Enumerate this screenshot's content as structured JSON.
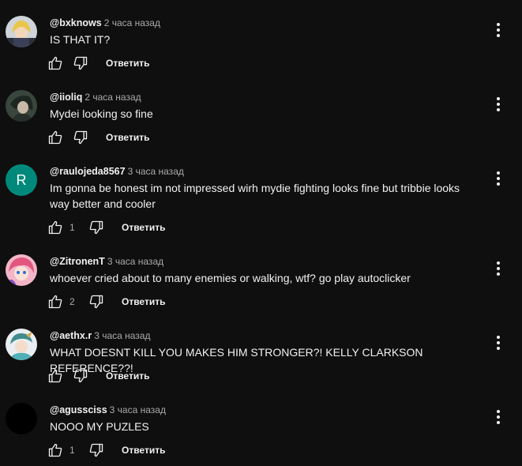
{
  "comments": [
    {
      "author": "@bxknows",
      "time": "2 часа назад",
      "lines": [
        "IS THAT IT?"
      ],
      "likes": "",
      "reply": "Ответить",
      "avatar": "avatar-bxknows"
    },
    {
      "author": "@iioliq",
      "time": "2 часа назад",
      "lines": [
        "Mydei looking so fine"
      ],
      "likes": "",
      "reply": "Ответить",
      "avatar": "avatar-iioliq"
    },
    {
      "author": "@raulojeda8567",
      "time": "3 часа назад",
      "lines": [
        "Im gonna be honest im not impressed wirh mydie fighting looks fine but tribbie looks",
        "way better and cooler"
      ],
      "likes": "1",
      "reply": "Ответить",
      "avatar_letter": "R",
      "avatar_color": "#00897b"
    },
    {
      "author": "@ZitronenT",
      "time": "3 часа назад",
      "lines": [
        "whoever cried about to many enemies or walking, wtf? go play autoclicker"
      ],
      "likes": "2",
      "reply": "Ответить",
      "avatar": "avatar-zitronent"
    },
    {
      "author": "@aethx.r",
      "time": "3 часа назад",
      "lines": [
        "WHAT DOESNT KILL YOU MAKES HIM STRONGER?! KELLY CLARKSON REFERENCE??!"
      ],
      "likes": "",
      "reply": "Ответить",
      "avatar": "avatar-aethx"
    },
    {
      "author": "@agussciss",
      "time": "3 часа назад",
      "lines": [
        "NOOO MY PUZLES"
      ],
      "likes": "1",
      "reply": "Ответить",
      "avatar": "avatar-agussciss"
    }
  ],
  "icons": {
    "like": "thumb-up-icon",
    "dislike": "thumb-down-icon",
    "more": "more-vert-icon"
  }
}
